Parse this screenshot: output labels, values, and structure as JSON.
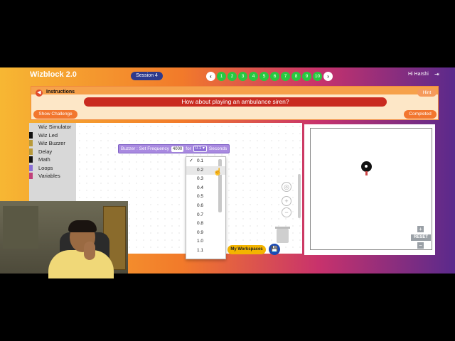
{
  "app": {
    "brand": "Wizblock 2.0",
    "session": "Session 4",
    "greeting": "Hi Harshi"
  },
  "nav": {
    "prev_icon": "chevron-left-icon",
    "next_icon": "chevron-right-icon",
    "logout_icon": "logout-icon",
    "steps": [
      "1",
      "2",
      "3",
      "4",
      "5",
      "6",
      "7",
      "8",
      "9",
      "10"
    ]
  },
  "instructions": {
    "title": "Instructions",
    "hint_label": "Hint",
    "question": "How about playing an ambulance siren?",
    "show_challenge_label": "Show Challenge",
    "completed_label": "Completed"
  },
  "palette": {
    "categories": [
      {
        "label": "Wiz Simulator",
        "color": "#d8d8d8"
      },
      {
        "label": "Wiz Led",
        "color": "#111111"
      },
      {
        "label": "Wiz Buzzer",
        "color": "#b89a3a"
      },
      {
        "label": "Delay",
        "color": "#b89a3a"
      },
      {
        "label": "Math",
        "color": "#111111"
      },
      {
        "label": "Loops",
        "color": "#8a6fd6"
      },
      {
        "label": "Variables",
        "color": "#c0407a"
      }
    ]
  },
  "block": {
    "prefix": "Buzzer : Set Frequency",
    "frequency": "4000",
    "for_label": "for",
    "duration": "0.1",
    "suffix": "Seconds"
  },
  "dropdown": {
    "selected": "0.1",
    "check": "✓",
    "options": [
      "0.1",
      "0.2",
      "0.3",
      "0.4",
      "0.5",
      "0.6",
      "0.7",
      "0.8",
      "0.9",
      "1.0",
      "1.1"
    ]
  },
  "workspace": {
    "my_workspaces_label": "My Workspaces"
  },
  "stage": {
    "reset_label": "RESET"
  },
  "colors": {
    "accent_green": "#28c840",
    "question_red": "#c92b20",
    "orange": "#f2762e",
    "save_blue": "#1b4ab5"
  }
}
